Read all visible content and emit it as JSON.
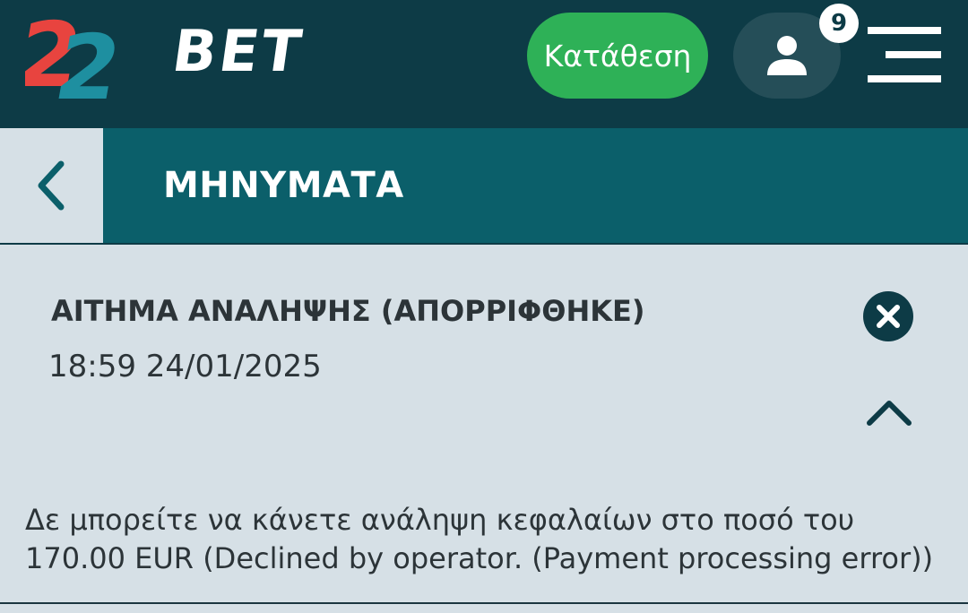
{
  "header": {
    "logo": {
      "numeral": "22",
      "text": "BET"
    },
    "deposit_label": "Κατάθεση",
    "notification_count": "9",
    "icons": {
      "profile": "user-icon",
      "menu": "hamburger-menu-icon"
    },
    "colors": {
      "background": "#0d3b46",
      "deposit": "#2eb157"
    }
  },
  "subheader": {
    "title": "ΜΗΝΥΜΑΤΑ",
    "back_icon": "chevron-left-icon",
    "background": "#0b5f6a"
  },
  "message": {
    "title": "ΑΙΤΗΜΑ ΑΝΑΛΗΨΗΣ (ΑΠΟΡΡΙΦΘΗΚΕ)",
    "datetime": "18:59 24/01/2025",
    "body": "Δε μπορείτε να κάνετε ανάληψη κεφαλαίων στο ποσό του 170.00 EUR (Declined by operator. (Payment processing error))",
    "delete_icon": "close-circle-icon",
    "collapse_icon": "chevron-up-icon",
    "expanded": true
  }
}
